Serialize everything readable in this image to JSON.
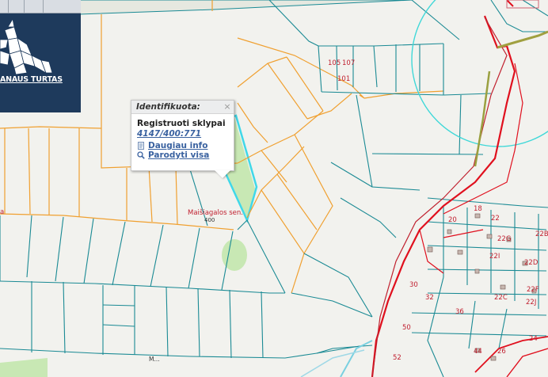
{
  "logo": {
    "text": "ANAUS TURTAS"
  },
  "popup": {
    "header": "Identifikuota:",
    "title": "Registruoti sklypai",
    "parcel_id": "4147/400:771",
    "more_info": "Daugiau info",
    "show_all": "Parodyti visa",
    "close_icon": "close-icon",
    "info_icon": "document-icon",
    "zoom_icon": "magnifier-icon"
  },
  "map_labels": {
    "place_name": "Maišiagalos sen.",
    "small_label": "400",
    "street": "M...",
    "left_edge": "a",
    "parcel_numbers": [
      "105",
      "107",
      "101",
      "18",
      "22",
      "20",
      "22B",
      "22G",
      "22I",
      "22D",
      "30",
      "32",
      "36",
      "22F",
      "22C",
      "22J",
      "50",
      "52",
      "44",
      "26",
      "24"
    ]
  },
  "colors": {
    "orange_boundary": "#f0a030",
    "teal_boundary": "#1a8a94",
    "red_boundary": "#e0101e",
    "highlight_fill": "#c8e8b4",
    "highlight_stroke": "#40d8e8",
    "logo_bg": "#1e3a5c",
    "label_red": "#c02030"
  }
}
